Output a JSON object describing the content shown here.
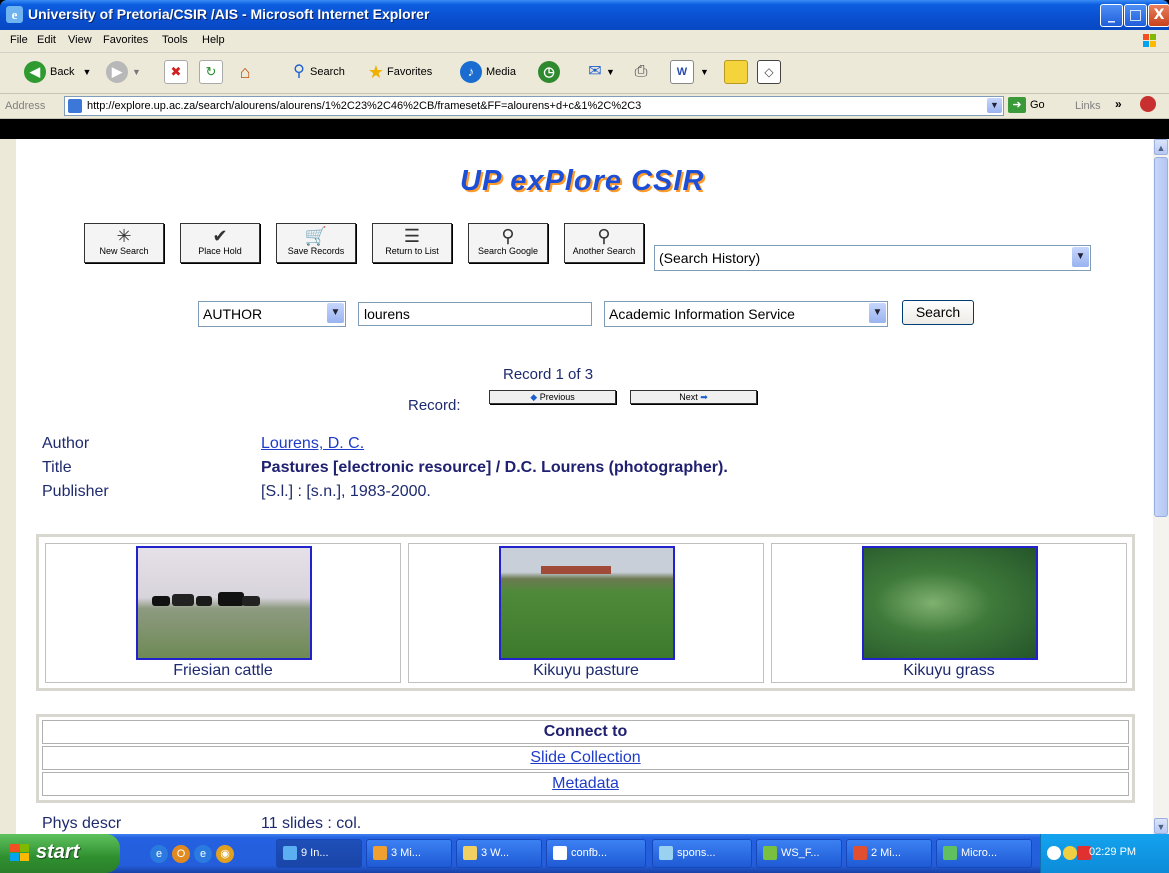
{
  "window": {
    "title": "University of Pretoria/CSIR /AIS - Microsoft Internet Explorer",
    "app_icon": "e",
    "min_glyph": "_",
    "max_glyph": "□",
    "close_glyph": "X"
  },
  "menubar": [
    "File",
    "Edit",
    "View",
    "Favorites",
    "Tools",
    "Help"
  ],
  "toolbar": {
    "back": "Back",
    "search": "Search",
    "favorites": "Favorites",
    "media": "Media"
  },
  "address": {
    "label": "Address",
    "url": "http://explore.up.ac.za/search/alourens/alourens/1%2C23%2C46%2CB/frameset&FF=alourens+d+c&1%2C%2C3",
    "go": "Go",
    "links": "Links"
  },
  "page": {
    "logo": "UP exPlore CSIR",
    "action_buttons": [
      {
        "label": "New Search",
        "icon": "new-search-icon"
      },
      {
        "label": "Place Hold",
        "icon": "checkmark-icon"
      },
      {
        "label": "Save Records",
        "icon": "cart-icon"
      },
      {
        "label": "Return to List",
        "icon": "list-icon"
      },
      {
        "label": "Search Google",
        "icon": "magnifier-icon"
      },
      {
        "label": "Another Search",
        "icon": "magnifier-icon"
      }
    ],
    "search_history": "(Search History)",
    "search": {
      "field": "AUTHOR",
      "query": "lourens",
      "scope": "Academic Information Service",
      "button": "Search"
    },
    "record_count": "Record 1 of 3",
    "record_label": "Record:",
    "previous": "Previous",
    "next": "Next",
    "fields": [
      {
        "label": "Author",
        "value": "Lourens, D. C."
      },
      {
        "label": "Title",
        "value": "Pastures [electronic resource] / D.C. Lourens (photographer)."
      },
      {
        "label": "Publisher",
        "value": "[S.l.] : [s.n.], 1983-2000."
      }
    ],
    "images": [
      {
        "caption": "Friesian cattle"
      },
      {
        "caption": "Kikuyu pasture"
      },
      {
        "caption": "Kikuyu grass"
      }
    ],
    "connect": {
      "header": "Connect to",
      "links": [
        "Slide Collection",
        "Metadata"
      ]
    },
    "phys_descr": {
      "label": "Phys descr",
      "value": "11 slides : col."
    }
  },
  "taskbar": {
    "start": "start",
    "tasks": [
      "9 In...",
      "3 Mi...",
      "3 W...",
      "confb...",
      "spons...",
      "WS_F...",
      "2 Mi...",
      "Micro..."
    ],
    "clock": "02:29 PM"
  },
  "colors": {
    "link": "#1e3cc8",
    "text": "#1e2a6e",
    "titlebar": "#0a4fd0",
    "taskbar": "#245edb",
    "start": "#3c9a3c"
  }
}
